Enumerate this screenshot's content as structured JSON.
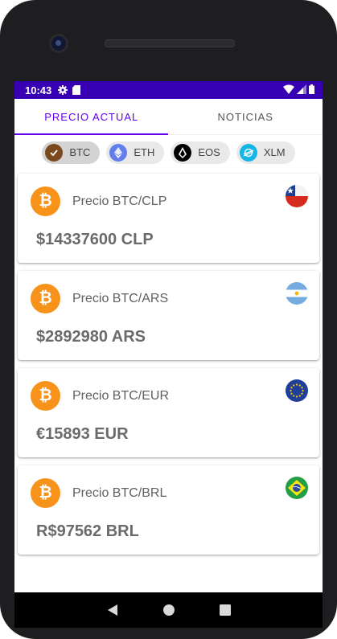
{
  "status_bar": {
    "time": "10:43"
  },
  "tabs": [
    {
      "label": "PRECIO ACTUAL"
    },
    {
      "label": "NOTICIAS"
    }
  ],
  "chips": [
    {
      "label": "BTC",
      "icon": "btc-check-icon",
      "selected": true
    },
    {
      "label": "ETH",
      "icon": "eth-icon"
    },
    {
      "label": "EOS",
      "icon": "eos-icon"
    },
    {
      "label": "XLM",
      "icon": "xlm-icon"
    }
  ],
  "cards": [
    {
      "pair": "Precio BTC/CLP",
      "price": "$14337600 CLP",
      "flag": "chile-flag-icon"
    },
    {
      "pair": "Precio BTC/ARS",
      "price": "$2892980 ARS",
      "flag": "argentina-flag-icon"
    },
    {
      "pair": "Precio BTC/EUR",
      "price": "€15893 EUR",
      "flag": "eu-flag-icon"
    },
    {
      "pair": "Precio BTC/BRL",
      "price": "R$97562 BRL",
      "flag": "brazil-flag-icon"
    }
  ],
  "colors": {
    "status_bar": "#3700b3",
    "accent": "#6200ee",
    "bitcoin": "#f7931a"
  }
}
